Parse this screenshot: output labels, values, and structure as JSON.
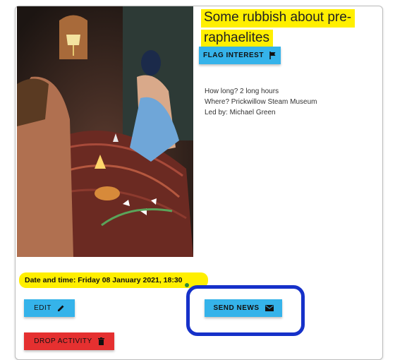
{
  "activity": {
    "title": "Some rubbish about pre-raphaelites",
    "flag_label": "FLAG INTEREST",
    "details": {
      "duration": "How long? 2 long hours",
      "location": "Where? Prickwillow Steam Museum",
      "leader": "Led by: Michael Green"
    },
    "datetime": "Date and time: Friday 08 January 2021, 18:30",
    "edit_label": "EDIT",
    "send_news_label": "SEND NEWS",
    "drop_label": "DROP ACTIVITY"
  },
  "icons": {
    "flag": "flag-icon",
    "edit": "pencil-icon",
    "send": "envelope-icon",
    "drop": "trash-icon"
  },
  "colors": {
    "highlight": "#ffef00",
    "primary_button": "#35b3ea",
    "danger_button": "#e53030",
    "annotation": "#1631c9"
  }
}
